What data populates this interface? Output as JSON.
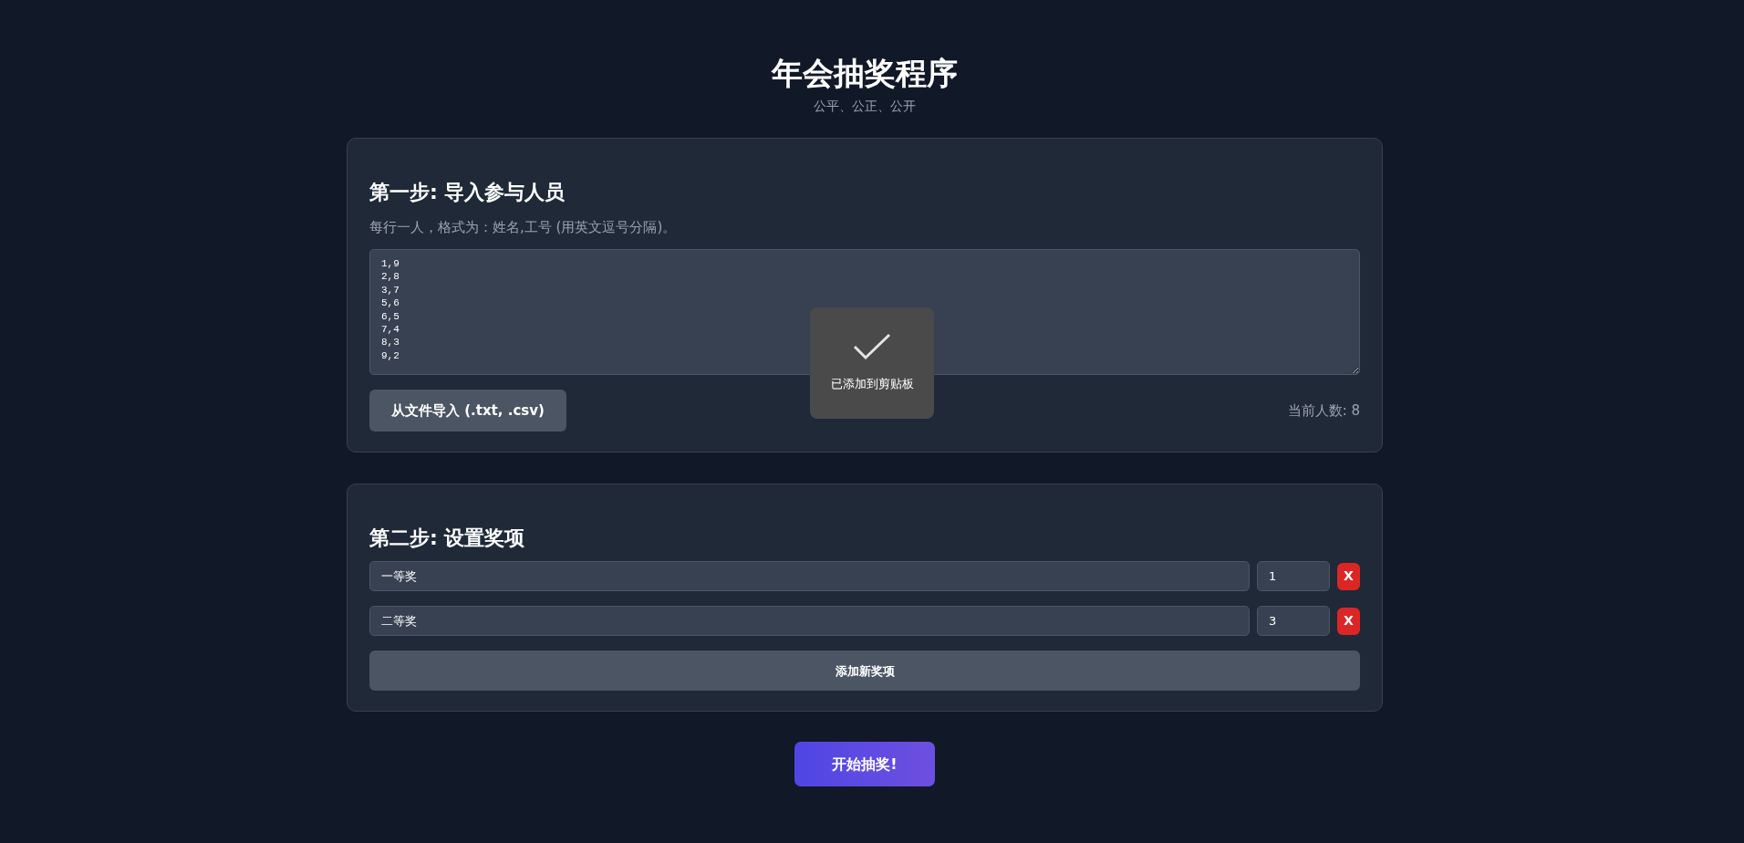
{
  "title": "年会抽奖程序",
  "subtitle": "公平、公正、公开",
  "step1": {
    "heading": "第一步: 导入参与人员",
    "hint": "每行一人，格式为：姓名,工号 (用英文逗号分隔)。",
    "participants": "1,9\n2,8\n3,7\n5,6\n6,5\n7,4\n8,3\n9,2",
    "import_button": "从文件导入 (.txt, .csv)",
    "count": "当前人数: 8"
  },
  "toast": {
    "text": "已添加到剪贴板"
  },
  "step2": {
    "heading": "第二步: 设置奖项",
    "prizes": [
      {
        "name": "一等奖",
        "count": "1",
        "remove": "X"
      },
      {
        "name": "二等奖",
        "count": "3",
        "remove": "X"
      }
    ],
    "add_button": "添加新奖项"
  },
  "start_button": "开始抽奖!"
}
